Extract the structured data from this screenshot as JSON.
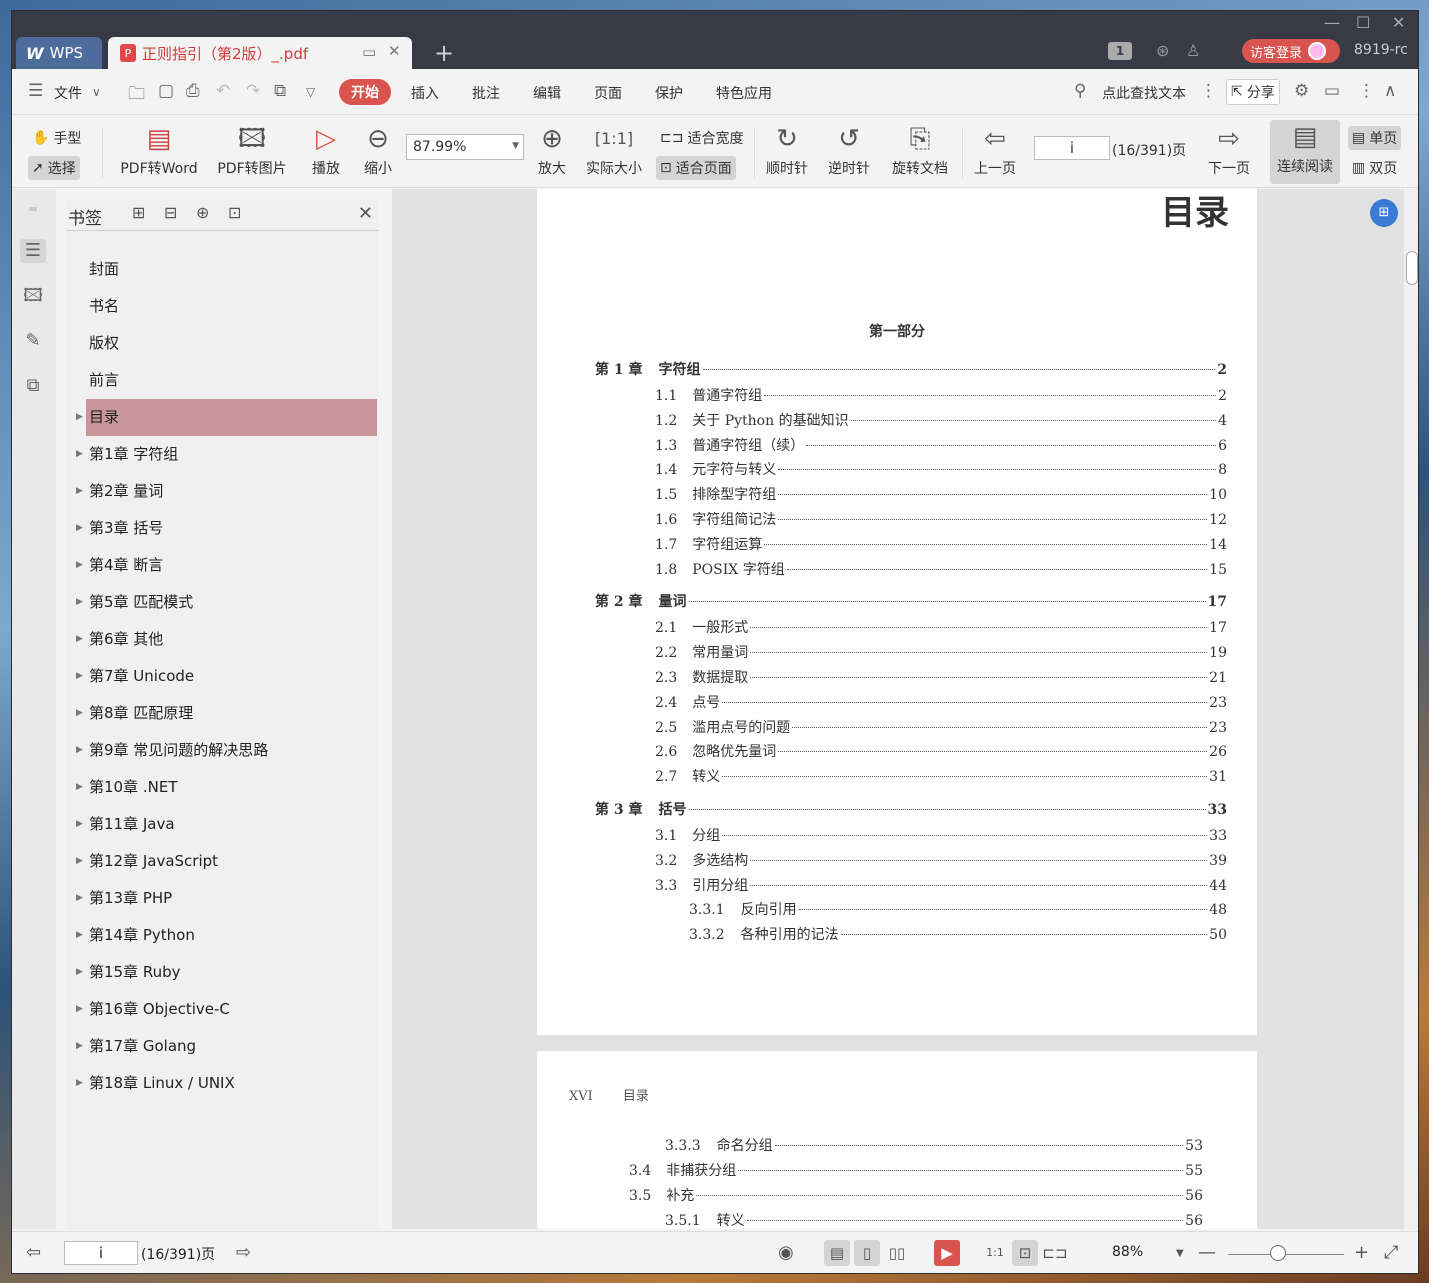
{
  "titlebar": {
    "wps_label": "WPS",
    "tab_title": "正则指引（第2版）_.pdf",
    "page_badge": "1",
    "visitor_login": "访客登录",
    "user": "8919-rc"
  },
  "menu": {
    "file": "文件",
    "items": [
      "开始",
      "插入",
      "批注",
      "编辑",
      "页面",
      "保护",
      "特色应用"
    ],
    "search": "点此查找文本",
    "share": "分享"
  },
  "toolbar": {
    "hand": "手型",
    "select": "选择",
    "pdf_to_word": "PDF转Word",
    "pdf_to_image": "PDF转图片",
    "play": "播放",
    "zoom_out": "缩小",
    "zoom_value": "87.99%",
    "zoom_in": "放大",
    "actual_size": "实际大小",
    "fit_width": "适合宽度",
    "fit_page": "适合页面",
    "clockwise": "顺时针",
    "counterclockwise": "逆时针",
    "rotate_doc": "旋转文档",
    "prev_page": "上一页",
    "page_input": "i",
    "page_total": "(16/391)页",
    "next_page": "下一页",
    "continuous": "连续阅读",
    "single": "单页",
    "double": "双页"
  },
  "bookmarks": {
    "title": "书签",
    "items": [
      {
        "label": "封面",
        "expandable": false
      },
      {
        "label": "书名",
        "expandable": false
      },
      {
        "label": "版权",
        "expandable": false
      },
      {
        "label": "前言",
        "expandable": false
      },
      {
        "label": "目录",
        "expandable": true,
        "selected": true
      },
      {
        "label": "第1章  字符组",
        "expandable": true
      },
      {
        "label": "第2章  量词",
        "expandable": true
      },
      {
        "label": "第3章  括号",
        "expandable": true
      },
      {
        "label": "第4章  断言",
        "expandable": true
      },
      {
        "label": "第5章  匹配模式",
        "expandable": true
      },
      {
        "label": "第6章  其他",
        "expandable": true
      },
      {
        "label": "第7章  Unicode",
        "expandable": true
      },
      {
        "label": "第8章  匹配原理",
        "expandable": true
      },
      {
        "label": "第9章  常见问题的解决思路",
        "expandable": true
      },
      {
        "label": "第10章  .NET",
        "expandable": true
      },
      {
        "label": "第11章  Java",
        "expandable": true
      },
      {
        "label": "第12章  JavaScript",
        "expandable": true
      },
      {
        "label": "第13章  PHP",
        "expandable": true
      },
      {
        "label": "第14章  Python",
        "expandable": true
      },
      {
        "label": "第15章  Ruby",
        "expandable": true
      },
      {
        "label": "第16章  Objective-C",
        "expandable": true
      },
      {
        "label": "第17章  Golang",
        "expandable": true
      },
      {
        "label": "第18章  Linux / UNIX",
        "expandable": true
      }
    ]
  },
  "page1": {
    "heading": "目录",
    "part": "第一部分",
    "toc": [
      {
        "level": 0,
        "num": "第 1 章",
        "text": "字符组",
        "page": "2"
      },
      {
        "level": 1,
        "num": "1.1",
        "text": "普通字符组",
        "page": "2"
      },
      {
        "level": 1,
        "num": "1.2",
        "text": "关于 Python 的基础知识",
        "page": "4"
      },
      {
        "level": 1,
        "num": "1.3",
        "text": "普通字符组（续）",
        "page": "6"
      },
      {
        "level": 1,
        "num": "1.4",
        "text": "元字符与转义",
        "page": "8"
      },
      {
        "level": 1,
        "num": "1.5",
        "text": "排除型字符组",
        "page": "10"
      },
      {
        "level": 1,
        "num": "1.6",
        "text": "字符组简记法",
        "page": "12"
      },
      {
        "level": 1,
        "num": "1.7",
        "text": "字符组运算",
        "page": "14"
      },
      {
        "level": 1,
        "num": "1.8",
        "text": "POSIX 字符组",
        "page": "15"
      },
      {
        "level": 0,
        "num": "第 2 章",
        "text": "量词",
        "page": "17"
      },
      {
        "level": 1,
        "num": "2.1",
        "text": "一般形式",
        "page": "17"
      },
      {
        "level": 1,
        "num": "2.2",
        "text": "常用量词",
        "page": "19"
      },
      {
        "level": 1,
        "num": "2.3",
        "text": "数据提取",
        "page": "21"
      },
      {
        "level": 1,
        "num": "2.4",
        "text": "点号",
        "page": "23"
      },
      {
        "level": 1,
        "num": "2.5",
        "text": "滥用点号的问题",
        "page": "23"
      },
      {
        "level": 1,
        "num": "2.6",
        "text": "忽略优先量词",
        "page": "26"
      },
      {
        "level": 1,
        "num": "2.7",
        "text": "转义",
        "page": "31"
      },
      {
        "level": 0,
        "num": "第 3 章",
        "text": "括号",
        "page": "33"
      },
      {
        "level": 1,
        "num": "3.1",
        "text": "分组",
        "page": "33"
      },
      {
        "level": 1,
        "num": "3.2",
        "text": "多选结构",
        "page": "39"
      },
      {
        "level": 1,
        "num": "3.3",
        "text": "引用分组",
        "page": "44"
      },
      {
        "level": 2,
        "num": "3.3.1",
        "text": "反向引用",
        "page": "48"
      },
      {
        "level": 2,
        "num": "3.3.2",
        "text": "各种引用的记法",
        "page": "50"
      }
    ]
  },
  "page2": {
    "header_num": "XVI",
    "header_title": "目录",
    "toc": [
      {
        "level": 2,
        "num": "3.3.3",
        "text": "命名分组",
        "page": "53"
      },
      {
        "level": 1,
        "num": "3.4",
        "text": "非捕获分组",
        "page": "55"
      },
      {
        "level": 1,
        "num": "3.5",
        "text": "补充",
        "page": "56"
      },
      {
        "level": 2,
        "num": "3.5.1",
        "text": "转义",
        "page": "56"
      }
    ]
  },
  "statusbar": {
    "page_input": "i",
    "page_total": "(16/391)页",
    "zoom": "88%",
    "zoom_fraction": 0.43
  }
}
